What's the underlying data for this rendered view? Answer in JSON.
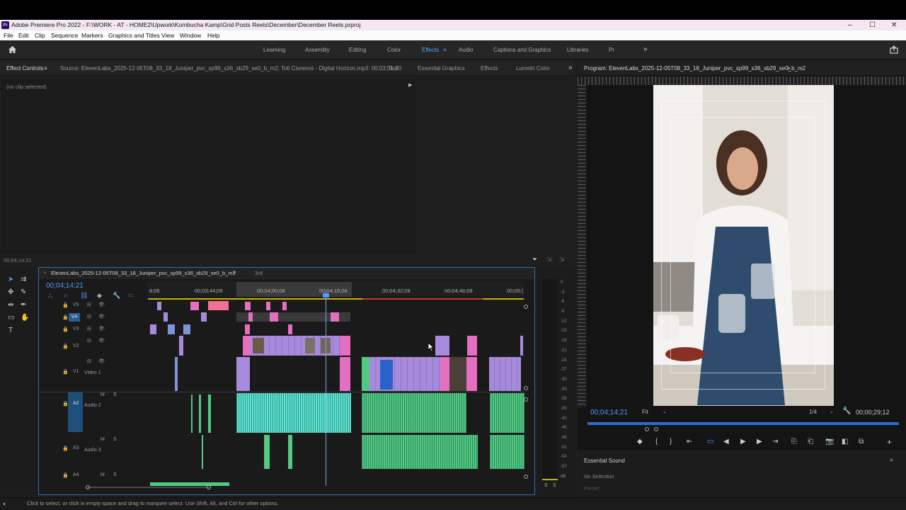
{
  "app": {
    "title": "Adobe Premiere Pro 2022 - F:\\WORK - AT - HOME2\\Upwork\\Kombucha Kamp\\Grid Posts Reels\\December\\December Reels.prproj",
    "logo_text": "Pr",
    "window_controls": [
      "–",
      "☐",
      "✕"
    ]
  },
  "menu": [
    "File",
    "Edit",
    "Clip",
    "Sequence",
    "Markers",
    "Graphics and Titles",
    "View",
    "Window",
    "Help"
  ],
  "workspaces": {
    "items": [
      "Learning",
      "Assembly",
      "Editing",
      "Color",
      "Effects",
      "Audio",
      "Captions and Graphics",
      "Libraries",
      "Pr"
    ],
    "active": "Effects",
    "more": "»"
  },
  "source_panel": {
    "tabs": [
      "Effect Controls",
      "Source: ElevenLabs_2025-12-05T08_33_18_Juniper_pvc_sp99_s36_sb29_se0_b_m2: Toti Cisneros - Digital Horizon.mp3: 00;03;51;20",
      "Text",
      "Essential Graphics",
      "Effects",
      "Lumetri Color"
    ],
    "no_clip": "(no clip selected)",
    "timecode": "00;04;14;21"
  },
  "program": {
    "title": "Program: ElevenLabs_2025-12-05T08_33_18_Juniper_pvc_sp99_s36_sb29_se0_b_m2",
    "timecode": "00;04;14;21",
    "fit": "Fit",
    "quality": "1/4",
    "duration": "00;00;29;12"
  },
  "timeline": {
    "tabs": [
      "ElevenLabs_2025-12-05T08_33_18_Juniper_pvc_sp99_s36_sb29_se0_b_m2",
      "3rd"
    ],
    "timecode": "00;04;14;21",
    "ruler": [
      "8;06",
      "00;03;44;06",
      "00;04;00;08",
      "00;04;16;08",
      "00;04;32;08",
      "00;04;48;08",
      "00;05;("
    ],
    "tracks": {
      "video": [
        "V5",
        "V4",
        "V3",
        "V2",
        "V1"
      ],
      "video1_name": "Video 1",
      "audio": [
        "A2",
        "A3",
        "A4"
      ],
      "audio2_name": "Audio 2",
      "audio3_name": "Audio 3",
      "toggles": [
        "M",
        "S"
      ]
    }
  },
  "meter": {
    "scale": [
      "0",
      "-3",
      "-6",
      "-9",
      "-12",
      "-15",
      "-18",
      "-21",
      "-24",
      "-27",
      "-30",
      "-33",
      "-36",
      "-39",
      "-42",
      "-45",
      "-48",
      "-51",
      "-54",
      "-57",
      "dB"
    ],
    "solo": [
      "S",
      "S"
    ]
  },
  "essential_sound": {
    "title": "Essential Sound",
    "no_selection": "No Selection",
    "preset": "Preset:"
  },
  "status": "Click to select, or click in empty space and drag to marquee select. Use Shift, Alt, and Ctrl for other options.",
  "colors": {
    "accent": "#5fa7ff",
    "video_clip": "#a88adc",
    "pink_clip": "#e46ec0",
    "audio_green": "#52c983",
    "audio_cyan": "#5de3d4"
  }
}
